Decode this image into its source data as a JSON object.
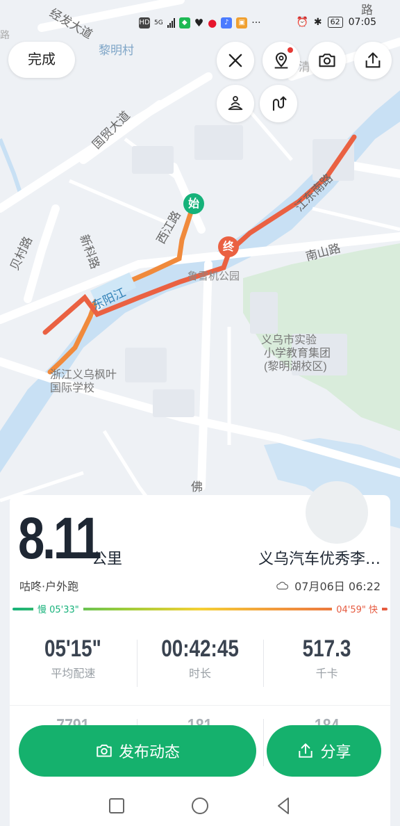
{
  "status_bar": {
    "left_icons": [
      "HD",
      "5G",
      "signal-icon",
      "app-icon",
      "heart-icon",
      "weibo-icon",
      "music-icon",
      "app2-icon",
      "more-icon"
    ],
    "battery": "62",
    "time": "07:05"
  },
  "map": {
    "labels": {
      "road_1": "经发大道",
      "road_2": "国贸大道",
      "road_3": "新科路",
      "road_4": "贝村路",
      "road_5": "西江路",
      "road_6": "江东南路",
      "road_7": "南山路",
      "village": "黎明村",
      "river": "东阳江",
      "park": "鲁雪机公园",
      "school_1": "义乌市实验小学教育集团(黎明湖校区)",
      "school_2": "浙江义乌枫叶国际学校",
      "road_8": "佛",
      "road_9": "清",
      "road_10": "路",
      "road_11": "路"
    },
    "start_marker": "始",
    "end_marker": "终"
  },
  "controls": {
    "done": "完成",
    "close_icon": "close-icon",
    "location_icon": "location-person-icon",
    "camera_icon": "camera-icon",
    "share_icon": "share-icon",
    "meditate_icon": "meditate-icon",
    "route_icon": "route-icon"
  },
  "summary": {
    "distance": "8.11",
    "unit": "公里",
    "location": "义乌汽车优秀李…",
    "source": "咕咚·户外跑",
    "weather_icon": "cloud-icon",
    "date": "07月06日 06:22"
  },
  "pace_bar": {
    "slow": "慢 05'33\"",
    "fast": "04'59\" 快",
    "colors": [
      "#16b27a",
      "#9ccc3a",
      "#f5d033",
      "#f29a3c",
      "#e65a3f"
    ]
  },
  "stats": [
    {
      "value": "05'15\"",
      "label": "平均配速"
    },
    {
      "value": "00:42:45",
      "label": "时长"
    },
    {
      "value": "517.3",
      "label": "千卡"
    }
  ],
  "stats_row2": [
    "7791",
    "181",
    "184"
  ],
  "actions": {
    "publish": "发布动态",
    "share": "分享",
    "accent": "#15b16d"
  }
}
